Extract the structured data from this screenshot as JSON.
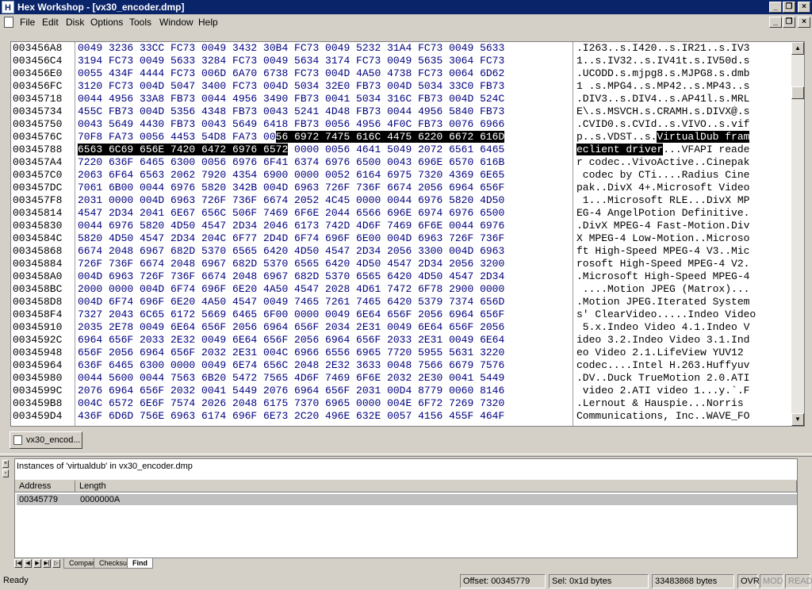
{
  "app": {
    "title": "Hex Workshop - [vx30_encoder.dmp]",
    "icon_letter": "H"
  },
  "window_buttons": {
    "minimize": "_",
    "restore": "❐",
    "close": "×"
  },
  "menu": [
    "File",
    "Edit",
    "Disk",
    "Options",
    "Tools",
    "Window",
    "Help"
  ],
  "hex_rows": [
    {
      "addr": "003456A8",
      "hex": "0049 3236 33CC FC73 0049 3432 30B4 FC73 0049 5232 31A4 FC73 0049 5633",
      "ascii": ".I263..s.I420..s.IR21..s.IV3"
    },
    {
      "addr": "003456C4",
      "hex": "3194 FC73 0049 5633 3284 FC73 0049 5634 3174 FC73 0049 5635 3064 FC73",
      "ascii": "1..s.IV32..s.IV41t.s.IV50d.s"
    },
    {
      "addr": "003456E0",
      "hex": "0055 434F 4444 FC73 006D 6A70 6738 FC73 004D 4A50 4738 FC73 0064 6D62",
      "ascii": ".UCODD.s.mjpg8.s.MJPG8.s.dmb"
    },
    {
      "addr": "003456FC",
      "hex": "3120 FC73 004D 5047 3400 FC73 004D 5034 32E0 FB73 004D 5034 33C0 FB73",
      "ascii": "1 .s.MPG4..s.MP42..s.MP43..s"
    },
    {
      "addr": "00345718",
      "hex": "0044 4956 33A8 FB73 0044 4956 3490 FB73 0041 5034 316C FB73 004D 524C",
      "ascii": ".DIV3..s.DIV4..s.AP41l.s.MRL"
    },
    {
      "addr": "00345734",
      "hex": "455C FB73 004D 5356 4348 FB73 0043 5241 4D48 FB73 0044 4956 5840 FB73",
      "ascii": "E\\.s.MSVCH.s.CRAMH.s.DIVX@.s"
    },
    {
      "addr": "00345750",
      "hex": "0043 5649 4430 FB73 0043 5649 6418 FB73 0056 4956 4F0C FB73 0076 6966",
      "ascii": ".CVID0.s.CVId..s.VIVO..s.vif"
    },
    {
      "addr": "0034576C",
      "hex": "70F8 FA73 0056 4453 54D8 FA73 00",
      "hexhl": "56 6972 7475 616C 4475 6220 6672 616D",
      "ascii": "p..s.VDST..s.",
      "asciihl": "VirtualDub fram"
    },
    {
      "addr": "00345788",
      "hexhl": "6563 6C69 656E 7420 6472 6976 6572",
      "hex": " 0000 0056 4641 5049 2072 6561 6465",
      "asciihl": "eclient driver",
      "ascii": "...VFAPI reade"
    },
    {
      "addr": "003457A4",
      "hex": "7220 636F 6465 6300 0056 6976 6F41 6374 6976 6500 0043 696E 6570 616B",
      "ascii": "r codec..VivoActive..Cinepak"
    },
    {
      "addr": "003457C0",
      "hex": "2063 6F64 6563 2062 7920 4354 6900 0000 0052 6164 6975 7320 4369 6E65",
      "ascii": " codec by CTi....Radius Cine"
    },
    {
      "addr": "003457DC",
      "hex": "7061 6B00 0044 6976 5820 342B 004D 6963 726F 736F 6674 2056 6964 656F",
      "ascii": "pak..DivX 4+.Microsoft Video"
    },
    {
      "addr": "003457F8",
      "hex": "2031 0000 004D 6963 726F 736F 6674 2052 4C45 0000 0044 6976 5820 4D50",
      "ascii": " 1...Microsoft RLE...DivX MP"
    },
    {
      "addr": "00345814",
      "hex": "4547 2D34 2041 6E67 656C 506F 7469 6F6E 2044 6566 696E 6974 6976 6500",
      "ascii": "EG-4 AngelPotion Definitive."
    },
    {
      "addr": "00345830",
      "hex": "0044 6976 5820 4D50 4547 2D34 2046 6173 742D 4D6F 7469 6F6E 0044 6976",
      "ascii": ".DivX MPEG-4 Fast-Motion.Div"
    },
    {
      "addr": "0034584C",
      "hex": "5820 4D50 4547 2D34 204C 6F77 2D4D 6F74 696F 6E00 004D 6963 726F 736F",
      "ascii": "X MPEG-4 Low-Motion..Microso"
    },
    {
      "addr": "00345868",
      "hex": "6674 2048 6967 682D 5370 6565 6420 4D50 4547 2D34 2056 3300 004D 6963",
      "ascii": "ft High-Speed MPEG-4 V3..Mic"
    },
    {
      "addr": "00345884",
      "hex": "726F 736F 6674 2048 6967 682D 5370 6565 6420 4D50 4547 2D34 2056 3200",
      "ascii": "rosoft High-Speed MPEG-4 V2."
    },
    {
      "addr": "003458A0",
      "hex": "004D 6963 726F 736F 6674 2048 6967 682D 5370 6565 6420 4D50 4547 2D34",
      "ascii": ".Microsoft High-Speed MPEG-4"
    },
    {
      "addr": "003458BC",
      "hex": "2000 0000 004D 6F74 696F 6E20 4A50 4547 2028 4D61 7472 6F78 2900 0000",
      "ascii": " ....Motion JPEG (Matrox)..."
    },
    {
      "addr": "003458D8",
      "hex": "004D 6F74 696F 6E20 4A50 4547 0049 7465 7261 7465 6420 5379 7374 656D",
      "ascii": ".Motion JPEG.Iterated System"
    },
    {
      "addr": "003458F4",
      "hex": "7327 2043 6C65 6172 5669 6465 6F00 0000 0049 6E64 656F 2056 6964 656F",
      "ascii": "s' ClearVideo.....Indeo Video"
    },
    {
      "addr": "00345910",
      "hex": "2035 2E78 0049 6E64 656F 2056 6964 656F 2034 2E31 0049 6E64 656F 2056",
      "ascii": " 5.x.Indeo Video 4.1.Indeo V"
    },
    {
      "addr": "0034592C",
      "hex": "6964 656F 2033 2E32 0049 6E64 656F 2056 6964 656F 2033 2E31 0049 6E64",
      "ascii": "ideo 3.2.Indeo Video 3.1.Ind"
    },
    {
      "addr": "00345948",
      "hex": "656F 2056 6964 656F 2032 2E31 004C 6966 6556 6965 7720 5955 5631 3220",
      "ascii": "eo Video 2.1.LifeView YUV12 "
    },
    {
      "addr": "00345964",
      "hex": "636F 6465 6300 0000 0049 6E74 656C 2048 2E32 3633 0048 7566 6679 7576",
      "ascii": "codec....Intel H.263.Huffyuv"
    },
    {
      "addr": "00345980",
      "hex": "0044 5600 0044 7563 6B20 5472 7565 4D6F 7469 6F6E 2032 2E30 0041 5449",
      "ascii": ".DV..Duck TrueMotion 2.0.ATI"
    },
    {
      "addr": "0034599C",
      "hex": "2076 6964 656F 2032 0041 5449 2076 6964 656F 2031 00D4 8779 0060 8146",
      "ascii": " video 2.ATI video 1...y.`.F"
    },
    {
      "addr": "003459B8",
      "hex": "004C 6572 6E6F 7574 2026 2048 6175 7370 6965 0000 004E 6F72 7269 7320",
      "ascii": ".Lernout & Hauspie...Norris "
    },
    {
      "addr": "003459D4",
      "hex": "436F 6D6D 756E 6963 6174 696F 6E73 2C20 496E 632E 0057 4156 455F 464F",
      "ascii": "Communications, Inc..WAVE_FO"
    }
  ],
  "doc_tab": {
    "label": "vx30_encod..."
  },
  "results": {
    "title": "Instances of 'virtualdub' in vx30_encoder.dmp",
    "columns": [
      "Address",
      "Length"
    ],
    "rows": [
      {
        "address": "00345779",
        "length": "0000000A"
      }
    ]
  },
  "bottom_tabs": [
    "Compare",
    "Checksum",
    "Find"
  ],
  "status": {
    "ready": "Ready",
    "offset": "Offset: 00345779",
    "sel": "Sel: 0x1d bytes",
    "size": "33483868 bytes",
    "ovr": "OVR",
    "mod": "MOD",
    "read": "READ"
  }
}
